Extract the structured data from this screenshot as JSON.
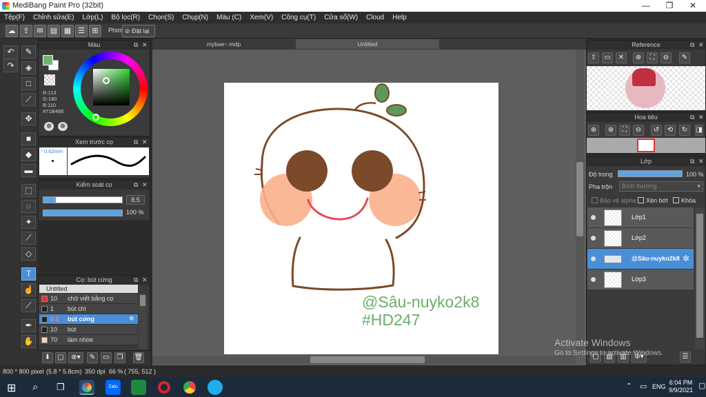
{
  "window": {
    "title": "MediBang Paint Pro (32bit)",
    "min": "—",
    "max": "❐",
    "close": "✕"
  },
  "menu": [
    "Tệp(F)",
    "Chỉnh sửa(E)",
    "Lớp(L)",
    "Bộ lọc(R)",
    "Chọn(S)",
    "Chụp(N)",
    "Màu (C)",
    "Xem(V)",
    "Công cụ(T)",
    "Cửa sổ(W)",
    "Cloud",
    "Help"
  ],
  "toolbar": {
    "shortcut_label": "Phím",
    "reset_label": "Đặt lại"
  },
  "color_panel": {
    "title": "Màu",
    "r": "R:113",
    "g": "G:180",
    "b": "B:110",
    "hex": "#71B46E",
    "fg_color": "#71b46e"
  },
  "brush_preview": {
    "title": "Xem trước cọ",
    "size": "* 0.62mm"
  },
  "brush_control": {
    "title": "Kiểm soát cọ",
    "size_value": "8.5",
    "opacity_value": "100 %"
  },
  "brush_list": {
    "title": "Cọ: bút cứng",
    "group": "Untitled",
    "items": [
      {
        "size": "10",
        "name": "chữ viết bằng cọ",
        "color": "#e63232"
      },
      {
        "size": "1",
        "name": "bút chì",
        "color": "#222222"
      },
      {
        "size": "8.5",
        "name": "bút cứng",
        "color": "#222222",
        "selected": true
      },
      {
        "size": "10",
        "name": "bút",
        "color": "#222222"
      },
      {
        "size": "70",
        "name": "làm nhòe",
        "color": "#f5d5c0"
      }
    ]
  },
  "tabs": {
    "doc1": "mybae~.mdp",
    "doc2": "Untitled"
  },
  "canvas": {
    "signature": "@Sâu-nuyko2k8",
    "hashtag": "#HD247"
  },
  "reference": {
    "title": "Reference"
  },
  "navigator": {
    "title": "Hoa tiêu"
  },
  "layers": {
    "title": "Lớp",
    "opacity_label": "Độ trong",
    "opacity_value": "100 %",
    "blend_label": "Pha trộn",
    "blend_value": "Bình thường",
    "protect_alpha": "Bảo vệ alpha",
    "clipping": "Xén bớt",
    "lock": "Khóa",
    "items": [
      {
        "name": "Lớp1"
      },
      {
        "name": "Lớp2"
      },
      {
        "name": "@Sâu-nuyko2k8",
        "selected": true
      },
      {
        "name": "Lớp3"
      }
    ]
  },
  "status": {
    "size": "800 * 800 pixel",
    "physical": "(5.8 * 5.8cm)",
    "dpi": "350 dpi",
    "zoom": "66 %",
    "coords": "( 755, 512 )"
  },
  "activate": {
    "line1": "Activate Windows",
    "line2": "Go to Settings to activate Windows."
  },
  "taskbar": {
    "time": "6:04 PM",
    "date": "9/9/2021",
    "lang": "ENG"
  }
}
